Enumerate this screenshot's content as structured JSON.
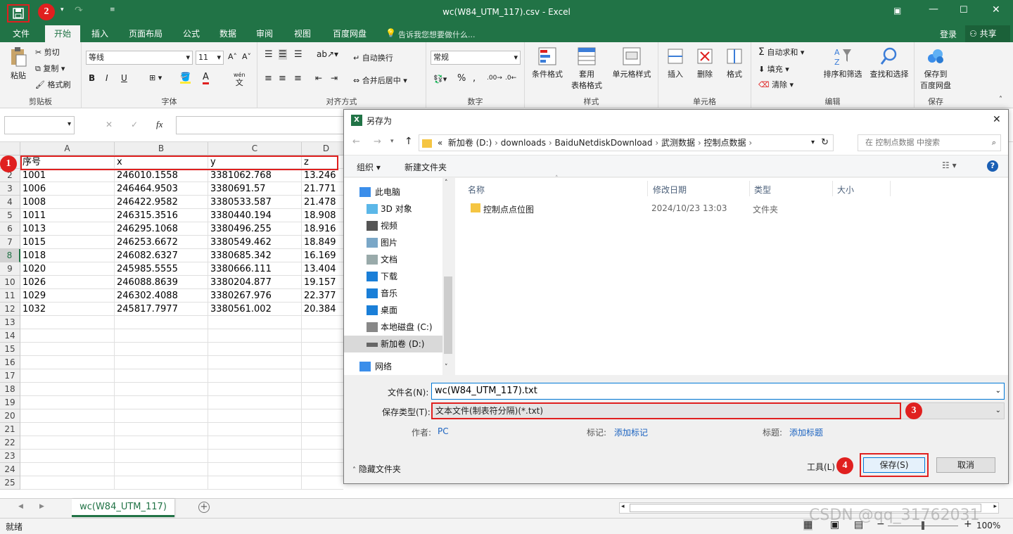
{
  "window": {
    "title": "wc(W84_UTM_117).csv - Excel"
  },
  "ribbon_tabs": [
    "文件",
    "开始",
    "插入",
    "页面布局",
    "公式",
    "数据",
    "审阅",
    "视图",
    "百度网盘"
  ],
  "tell_me": "告诉我您想要做什么...",
  "login": "登录",
  "share": "共享",
  "clipboard": {
    "paste": "粘贴",
    "cut": "剪切",
    "copy": "复制",
    "painter": "格式刷",
    "label": "剪贴板"
  },
  "font": {
    "name": "等线",
    "size": "11",
    "label": "字体",
    "bold": "B",
    "italic": "I",
    "underline": "U",
    "wen": "wén",
    "wen2": "文"
  },
  "align": {
    "wrap": "自动换行",
    "merge": "合并后居中",
    "label": "对齐方式"
  },
  "number": {
    "format": "常规",
    "label": "数字"
  },
  "styles": {
    "cond": "条件格式",
    "table1": "套用",
    "table2": "表格格式",
    "cell": "单元格样式",
    "label": "样式"
  },
  "cells": {
    "insert": "插入",
    "delete": "删除",
    "format": "格式",
    "label": "单元格"
  },
  "editing": {
    "autosum": "自动求和",
    "fill": "填充",
    "clear": "清除",
    "sort": "排序和筛选",
    "find": "查找和选择",
    "label": "编辑"
  },
  "baidu": {
    "save1": "保存到",
    "save2": "百度网盘",
    "label": "保存"
  },
  "formula_bar": {
    "fx": "fx",
    "cancel": "✕",
    "enter": "✓"
  },
  "columns": [
    "A",
    "B",
    "C",
    "D"
  ],
  "rows": [
    "1",
    "2",
    "3",
    "4",
    "5",
    "6",
    "7",
    "8",
    "9",
    "10",
    "11",
    "12",
    "13",
    "14",
    "15",
    "16",
    "17",
    "18",
    "19",
    "20",
    "21",
    "22",
    "23",
    "24",
    "25"
  ],
  "table": [
    [
      "序号",
      "x",
      "y",
      "z"
    ],
    [
      "1001",
      "246010.1558",
      "3381062.768",
      "13.246"
    ],
    [
      "1006",
      "246464.9503",
      "3380691.57",
      "21.771"
    ],
    [
      "1008",
      "246422.9582",
      "3380533.587",
      "21.478"
    ],
    [
      "1011",
      "246315.3516",
      "3380440.194",
      "18.908"
    ],
    [
      "1013",
      "246295.1068",
      "3380496.255",
      "18.916"
    ],
    [
      "1015",
      "246253.6672",
      "3380549.462",
      "18.849"
    ],
    [
      "1018",
      "246082.6327",
      "3380685.342",
      "16.169"
    ],
    [
      "1020",
      "245985.5555",
      "3380666.111",
      "13.404"
    ],
    [
      "1026",
      "246088.8639",
      "3380204.877",
      "19.157"
    ],
    [
      "1029",
      "246302.4088",
      "3380267.976",
      "22.377"
    ],
    [
      "1032",
      "245817.7977",
      "3380561.002",
      "20.384"
    ]
  ],
  "dialog": {
    "title": "另存为",
    "breadcrumb": [
      "«",
      "新加卷 (D:)",
      "downloads",
      "BaiduNetdiskDownload",
      "武测数据",
      "控制点数据"
    ],
    "search_placeholder": "在 控制点数据 中搜索",
    "organize": "组织 ▾",
    "new_folder": "新建文件夹",
    "nav": [
      "此电脑",
      "3D 对象",
      "视频",
      "图片",
      "文档",
      "下载",
      "音乐",
      "桌面",
      "本地磁盘 (C:)",
      "新加卷 (D:)",
      "网络"
    ],
    "headers": [
      "名称",
      "修改日期",
      "类型",
      "大小"
    ],
    "files": [
      {
        "name": "控制点点位图",
        "date": "2024/10/23 13:03",
        "type": "文件夹"
      }
    ],
    "filename_label": "文件名(N):",
    "filename": "wc(W84_UTM_117).txt",
    "filetype_label": "保存类型(T):",
    "filetype": "文本文件(制表符分隔)(*.txt)",
    "author_label": "作者:",
    "author": "PC",
    "tags_label": "标记:",
    "tags": "添加标记",
    "titlef_label": "标题:",
    "titlef": "添加标题",
    "hide": "隐藏文件夹",
    "tools": "工具(L)",
    "save": "保存(S)",
    "cancel": "取消"
  },
  "badges": [
    "1",
    "2",
    "3",
    "4"
  ],
  "sheet_tab": "wc(W84_UTM_117)",
  "status": "就绪",
  "zoom": "100%",
  "watermark": "CSDN @qq_31762031",
  "colors": {
    "excel_green": "#217346",
    "highlight_red": "#e0201f",
    "link_blue": "#1a62c0"
  }
}
